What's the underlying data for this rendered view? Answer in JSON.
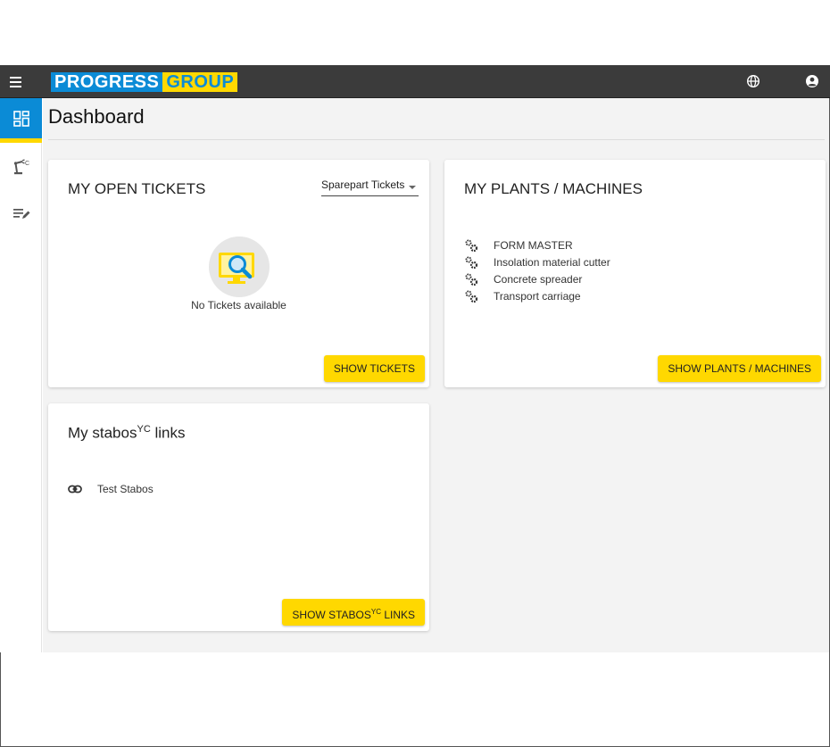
{
  "header": {
    "logo_part1": "PROGRESS",
    "logo_part2": "GROUP",
    "menu_icon": "hamburger-icon",
    "language_icon": "globe-icon",
    "account_icon": "user-circle-icon"
  },
  "sidebar": {
    "items": [
      {
        "icon": "dashboard-icon",
        "active": true
      },
      {
        "icon": "robot-arm-icon",
        "active": false
      },
      {
        "icon": "edit-list-icon",
        "active": false
      }
    ]
  },
  "page": {
    "title": "Dashboard"
  },
  "tickets_card": {
    "title": "MY OPEN TICKETS",
    "filter_value": "Sparepart Tickets",
    "empty_text": "No Tickets available",
    "button": "SHOW TICKETS"
  },
  "plants_card": {
    "title": "MY PLANTS / MACHINES",
    "items": [
      "FORM MASTER",
      "Insolation material cutter",
      "Concrete spreader",
      "Transport carriage"
    ],
    "button": "SHOW PLANTS / MACHINES"
  },
  "links_card": {
    "title_main": "My stabos",
    "title_sup": "YC",
    "title_end": " links",
    "items": [
      "Test Stabos"
    ],
    "button_main": "SHOW STABOS",
    "button_sup": "YC",
    "button_end": " LINKS"
  },
  "colors": {
    "brand_blue": "#0b8bd6",
    "brand_yellow": "#ffd800",
    "topbar": "#3b3b3b"
  }
}
